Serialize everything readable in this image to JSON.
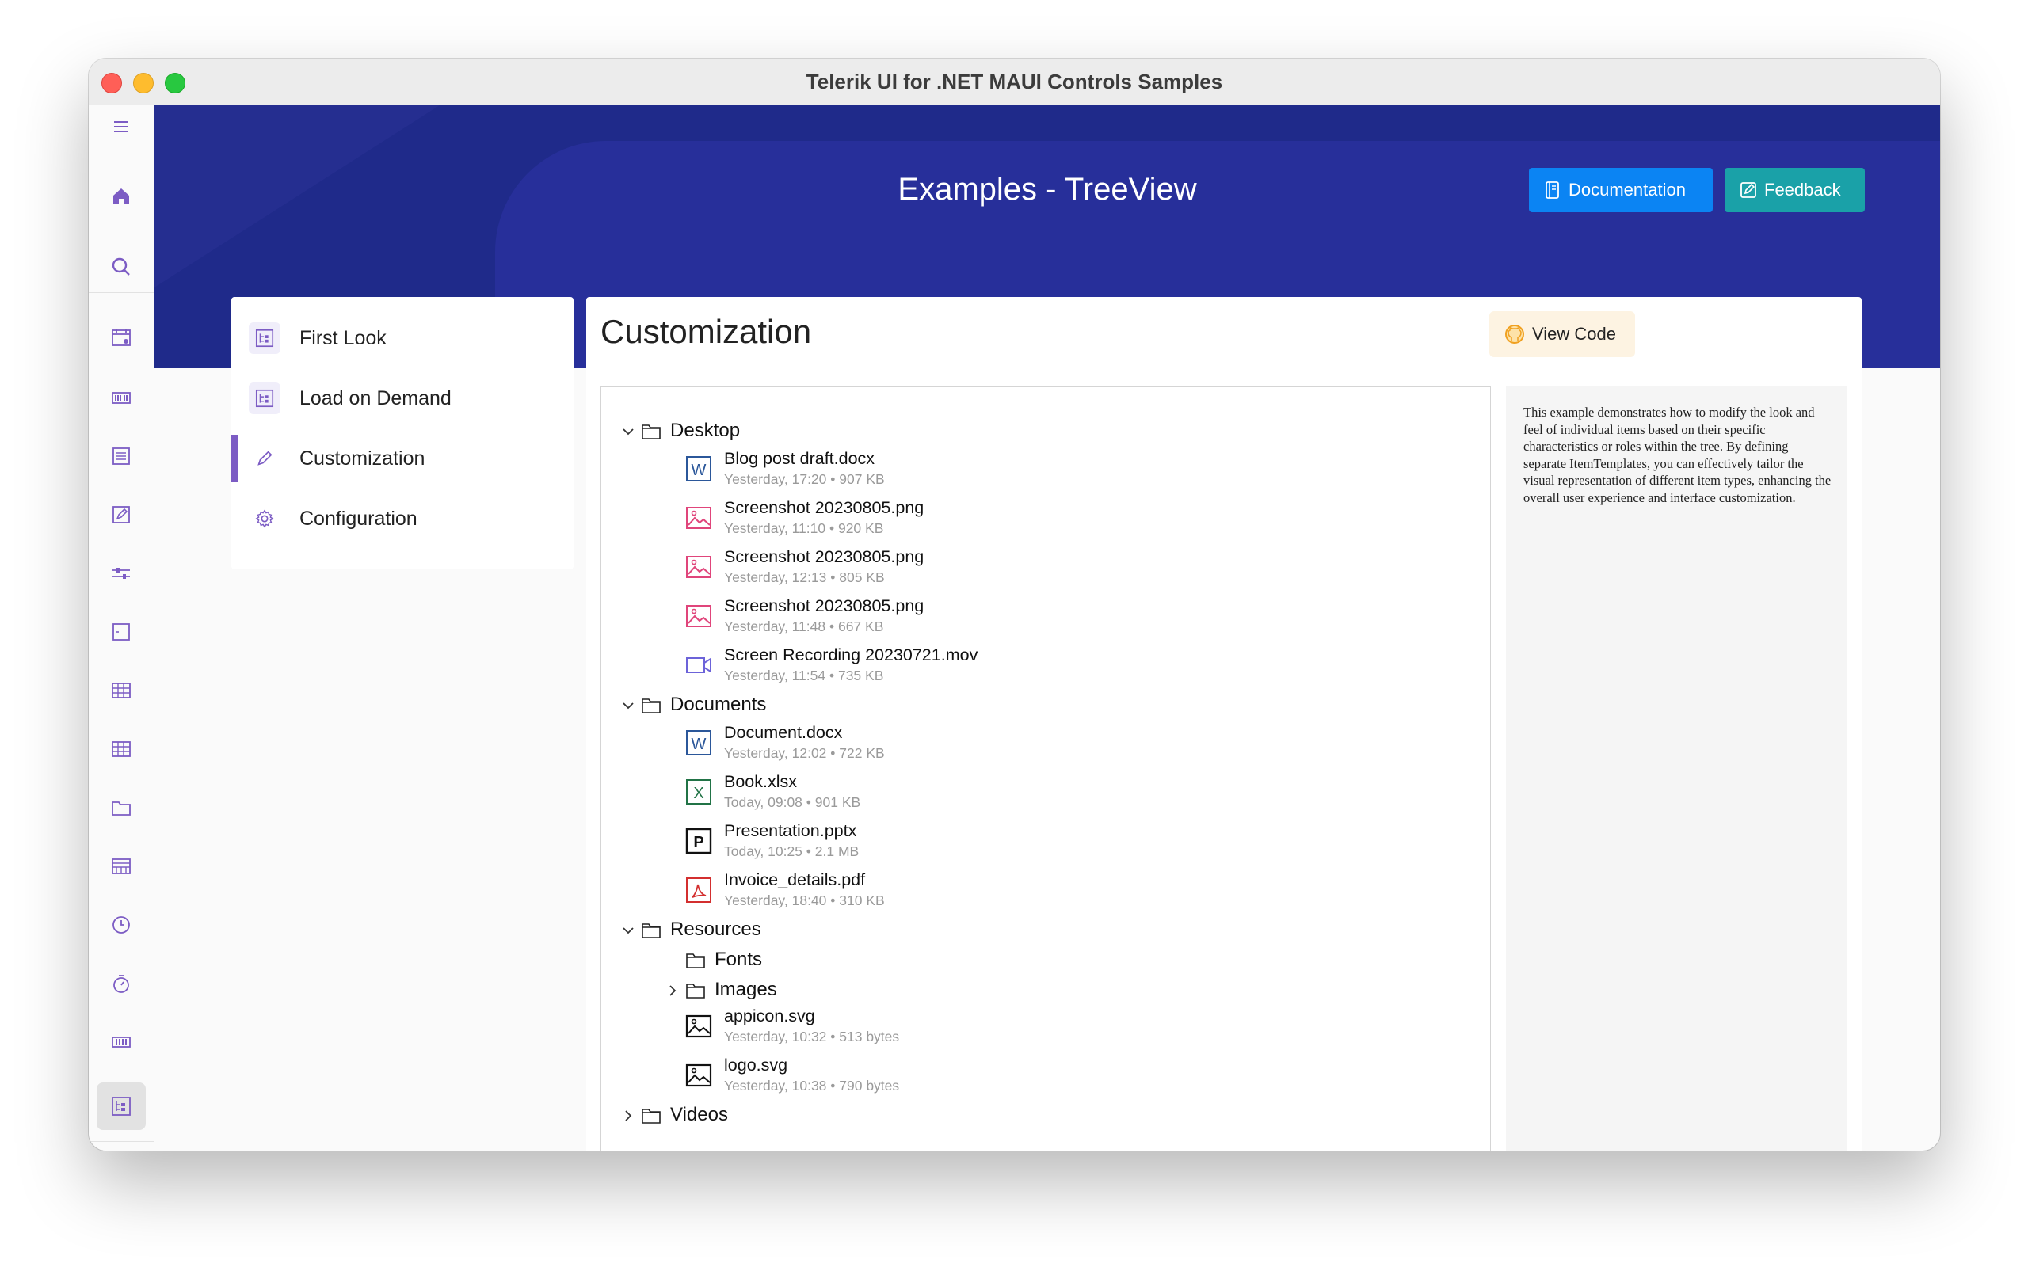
{
  "window": {
    "title": "Telerik UI for .NET MAUI Controls Samples"
  },
  "rail": {
    "icons": [
      "hamburger-menu-icon",
      "home-icon",
      "search-icon",
      "calendar-icon",
      "barcode-icon",
      "list-icon",
      "edit-form-icon",
      "slider-icon",
      "border-icon",
      "grid-icon",
      "datagrid-icon",
      "folder-icon",
      "scheduler-icon",
      "clock-icon",
      "timer-icon",
      "rangebar-icon",
      "treeview-icon",
      "settings-icon"
    ]
  },
  "header": {
    "title": "Examples - TreeView",
    "documentation_label": "Documentation",
    "feedback_label": "Feedback"
  },
  "nav": {
    "items": [
      {
        "label": "First Look",
        "icon": "treeview-icon",
        "active": false
      },
      {
        "label": "Load on Demand",
        "icon": "treeview-icon",
        "active": false
      },
      {
        "label": "Customization",
        "icon": "pencil-icon",
        "active": true
      },
      {
        "label": "Configuration",
        "icon": "gear-icon",
        "active": false
      }
    ]
  },
  "main": {
    "title": "Customization",
    "view_code_label": "View Code",
    "description": "This example demonstrates how to modify the look and feel of individual items based on their specific characteristics or roles within the tree. By defining separate ItemTemplates, you can effectively tailor the visual representation of different item types, enhancing the overall user experience and interface customization."
  },
  "tree": {
    "desktop": {
      "label": "Desktop",
      "files": [
        {
          "name": "Blog post draft.docx",
          "meta": "Yesterday, 17:20 • 907 KB",
          "type": "word"
        },
        {
          "name": "Screenshot 20230805.png",
          "meta": "Yesterday, 11:10 • 920 KB",
          "type": "image"
        },
        {
          "name": "Screenshot 20230805.png",
          "meta": "Yesterday, 12:13 • 805 KB",
          "type": "image"
        },
        {
          "name": "Screenshot 20230805.png",
          "meta": "Yesterday, 11:48 • 667 KB",
          "type": "image"
        },
        {
          "name": "Screen Recording 20230721.mov",
          "meta": "Yesterday, 11:54 • 735 KB",
          "type": "video"
        }
      ]
    },
    "documents": {
      "label": "Documents",
      "files": [
        {
          "name": "Document.docx",
          "meta": "Yesterday, 12:02 • 722 KB",
          "type": "word"
        },
        {
          "name": "Book.xlsx",
          "meta": "Today, 09:08 • 901 KB",
          "type": "excel"
        },
        {
          "name": "Presentation.pptx",
          "meta": "Today, 10:25 • 2.1 MB",
          "type": "powerpoint"
        },
        {
          "name": "Invoice_details.pdf",
          "meta": "Yesterday, 18:40 • 310 KB",
          "type": "pdf"
        }
      ]
    },
    "resources": {
      "label": "Resources",
      "fonts_label": "Fonts",
      "images_label": "Images",
      "files": [
        {
          "name": "appicon.svg",
          "meta": "Yesterday, 10:32 • 513 bytes",
          "type": "svg"
        },
        {
          "name": "logo.svg",
          "meta": "Yesterday, 10:38 • 790 bytes",
          "type": "svg"
        }
      ]
    },
    "videos": {
      "label": "Videos"
    }
  },
  "colors": {
    "header_bg": "#1f2a8a",
    "accent_purple": "#7c5cc4",
    "documentation_button": "#0b84f3",
    "feedback_button": "#1aa1a8",
    "word": "#2b579a",
    "excel": "#217346",
    "pdf": "#d32f2f",
    "image": "#e0457b",
    "video": "#6c63d9"
  }
}
